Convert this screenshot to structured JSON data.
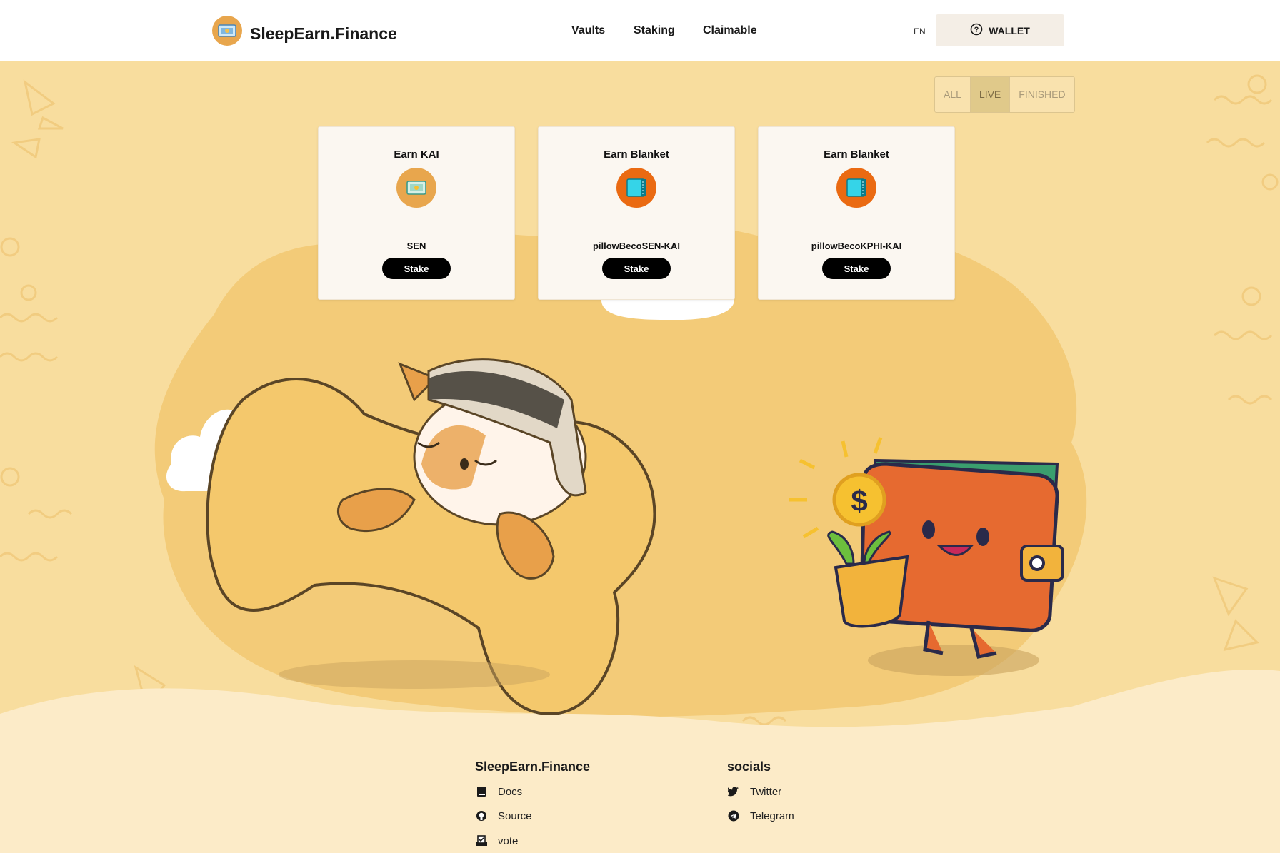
{
  "header": {
    "brand": "SleepEarn.Finance",
    "nav": [
      "Vaults",
      "Staking",
      "Claimable"
    ],
    "lang": "EN",
    "wallet_label": "WALLET"
  },
  "filter": {
    "options": [
      "ALL",
      "LIVE",
      "FINISHED"
    ],
    "active": "LIVE"
  },
  "pools": [
    {
      "title": "Earn KAI",
      "token": "SEN",
      "button": "Stake",
      "icon": "sen-token-icon"
    },
    {
      "title": "Earn Blanket",
      "token": "pillowBecoSEN-KAI",
      "button": "Stake",
      "icon": "blanket-token-icon"
    },
    {
      "title": "Earn Blanket",
      "token": "pillowBecoKPHI-KAI",
      "button": "Stake",
      "icon": "blanket-token-icon"
    }
  ],
  "footer": {
    "brand": "SleepEarn.Finance",
    "links": [
      "Docs",
      "Source",
      "vote"
    ],
    "socials_title": "socials",
    "socials": [
      "Twitter",
      "Telegram"
    ]
  },
  "colors": {
    "background": "#fbe6b8",
    "accent": "#000000",
    "card": "#fbf7f1"
  }
}
